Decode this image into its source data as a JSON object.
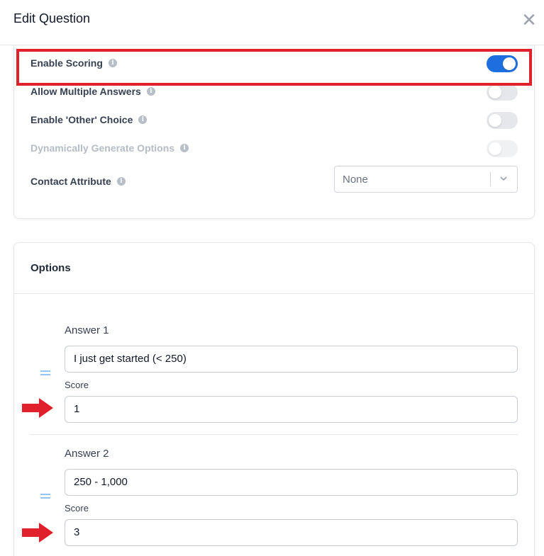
{
  "header": {
    "title": "Edit Question",
    "close_label": "✕"
  },
  "settings": [
    {
      "label": "Enable Scoring",
      "on": true,
      "disabled": false
    },
    {
      "label": "Allow Multiple Answers",
      "on": false,
      "disabled": false
    },
    {
      "label": "Enable 'Other' Choice",
      "on": false,
      "disabled": false
    },
    {
      "label": "Dynamically Generate Options",
      "on": false,
      "disabled": true
    }
  ],
  "contact_attribute": {
    "label": "Contact Attribute",
    "value": "None"
  },
  "info_glyph": "i",
  "options": {
    "title": "Options",
    "answers": [
      {
        "label": "Answer 1",
        "value": "I just get started (< 250)",
        "score_label": "Score",
        "score": "1"
      },
      {
        "label": "Answer 2",
        "value": "250 - 1,000",
        "score_label": "Score",
        "score": "3"
      }
    ]
  },
  "colors": {
    "accent": "#1d6fe0",
    "highlight": "#e0202a",
    "arrow": "#e0202a"
  }
}
